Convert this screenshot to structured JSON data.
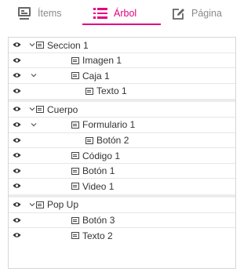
{
  "tabs": [
    {
      "label": "Ítems",
      "icon": "items-icon",
      "active": false
    },
    {
      "label": "Árbol",
      "icon": "tree-icon",
      "active": true
    },
    {
      "label": "Página",
      "icon": "page-edit-icon",
      "active": false
    }
  ],
  "accent_color": "#e5007e",
  "tree": [
    {
      "nodes": [
        {
          "label": "Seccion 1",
          "level": 0,
          "expandable": true
        },
        {
          "label": "Imagen 1",
          "level": 2,
          "expandable": false
        },
        {
          "label": "Caja 1",
          "level": 2,
          "expandable": true
        },
        {
          "label": "Texto 1",
          "level": 3,
          "expandable": false
        }
      ]
    },
    {
      "nodes": [
        {
          "label": "Cuerpo",
          "level": 0,
          "expandable": true
        },
        {
          "label": "Formulario 1",
          "level": 2,
          "expandable": true
        },
        {
          "label": "Botón 2",
          "level": 3,
          "expandable": false
        },
        {
          "label": "Código 1",
          "level": 2,
          "expandable": false
        },
        {
          "label": "Botón 1",
          "level": 2,
          "expandable": false
        },
        {
          "label": "Video 1",
          "level": 2,
          "expandable": false
        }
      ]
    },
    {
      "nodes": [
        {
          "label": "Pop Up",
          "level": 0,
          "expandable": true
        },
        {
          "label": "Botón 3",
          "level": 2,
          "expandable": false
        },
        {
          "label": "Texto 2",
          "level": 2,
          "expandable": false
        }
      ]
    }
  ]
}
